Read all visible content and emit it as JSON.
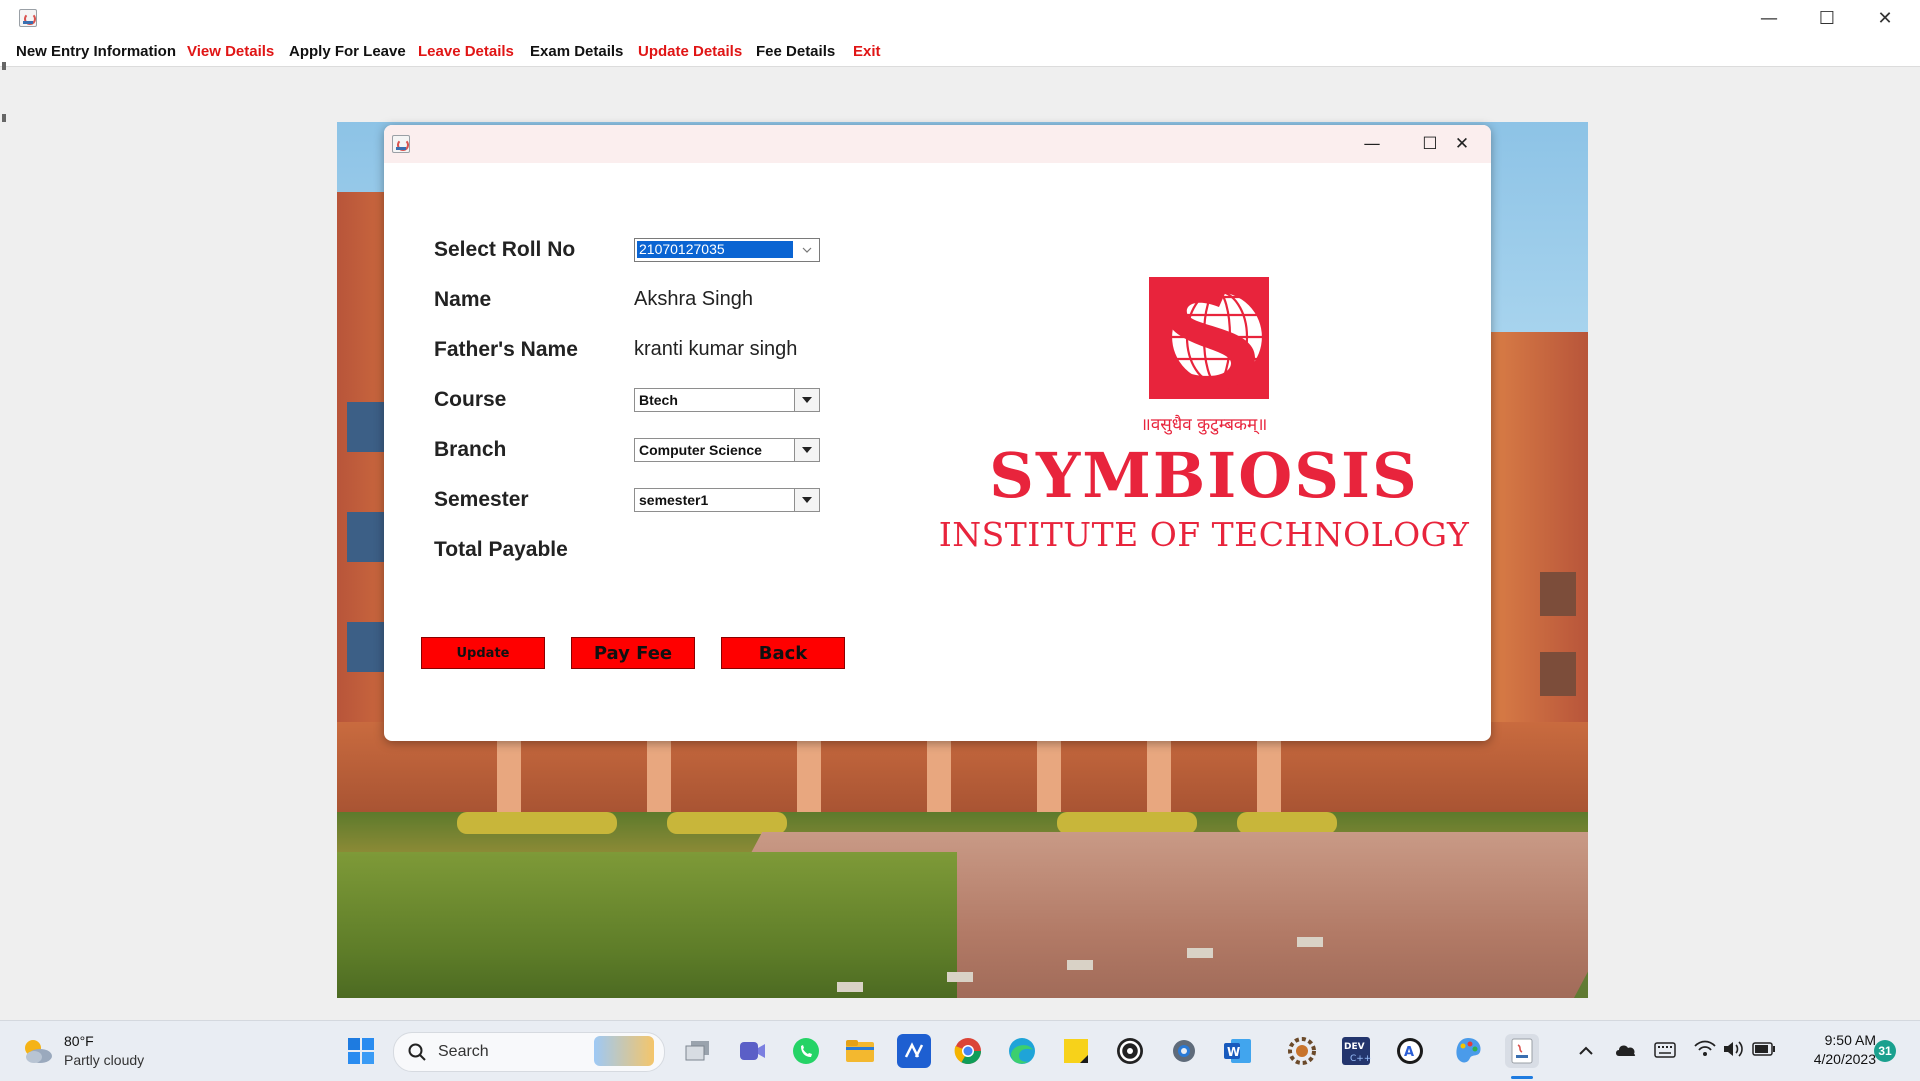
{
  "main_window": {
    "menu": [
      {
        "label": "New Entry Information",
        "color": "#111111"
      },
      {
        "label": "View Details",
        "color": "#e01515"
      },
      {
        "label": "Apply For Leave",
        "color": "#111111"
      },
      {
        "label": "Leave Details",
        "color": "#e01515"
      },
      {
        "label": "Exam Details",
        "color": "#111111"
      },
      {
        "label": "Update Details",
        "color": "#e01515"
      },
      {
        "label": "Fee Details",
        "color": "#111111"
      },
      {
        "label": "Exit",
        "color": "#e01515"
      }
    ],
    "controls": {
      "minimize": "—",
      "maximize": "☐",
      "close": "✕"
    }
  },
  "dialog": {
    "controls": {
      "minimize": "—",
      "maximize": "☐",
      "close": "✕"
    },
    "labels": {
      "roll": "Select Roll No",
      "name": "Name",
      "father": "Father's Name",
      "course": "Course",
      "branch": "Branch",
      "semester": "Semester",
      "total": "Total Payable"
    },
    "values": {
      "roll": "21070127035",
      "name": "Akshra Singh",
      "father": "kranti kumar singh",
      "course": "Btech",
      "branch": "Computer Science",
      "semester": "semester1",
      "total": ""
    },
    "buttons": {
      "update": "Update",
      "pay": "Pay Fee",
      "back": "Back"
    },
    "logo": {
      "motto": "॥वसुधैव कुटुम्बकम्॥",
      "name": "SYMBIOSIS",
      "subtitle": "INSTITUTE OF TECHNOLOGY",
      "color": "#e8243c"
    }
  },
  "taskbar": {
    "weather": {
      "temp": "80°F",
      "condition": "Partly cloudy"
    },
    "search_label": "Search",
    "clock": {
      "time": "9:50 AM",
      "date": "4/20/2023"
    },
    "notification_count": "31",
    "apps": [
      "start-icon",
      "search-icon",
      "copilot-icon",
      "task-view-icon",
      "teams-icon",
      "whatsapp-icon",
      "file-explorer-icon",
      "vscode-icon",
      "chrome-icon",
      "edge-icon",
      "sticky-notes-icon",
      "obs-icon",
      "settings-icon",
      "word-icon",
      "gear-app-icon",
      "devcpp-icon",
      "app-icon",
      "paint-icon",
      "java-icon"
    ]
  }
}
